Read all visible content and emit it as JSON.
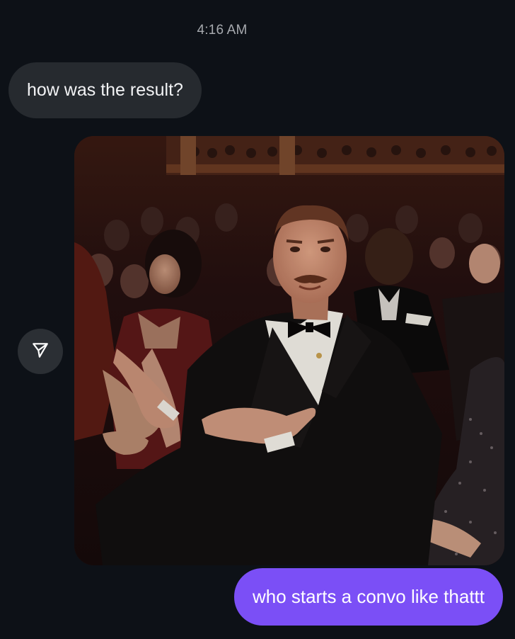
{
  "conversation": {
    "timestamp": "4:16 AM",
    "messages": [
      {
        "direction": "incoming",
        "type": "text",
        "text": "how was the result?"
      },
      {
        "direction": "outgoing",
        "type": "media",
        "media_kind": "gif"
      },
      {
        "direction": "outgoing",
        "type": "text",
        "text": "who starts a convo like thattt"
      }
    ]
  },
  "actions": {
    "share_icon": "send-icon"
  },
  "colors": {
    "background": "#0d1117",
    "incoming_bubble": "#262a2f",
    "outgoing_bubble": "#7b4ff6",
    "timestamp_text": "#a6a9ae"
  }
}
